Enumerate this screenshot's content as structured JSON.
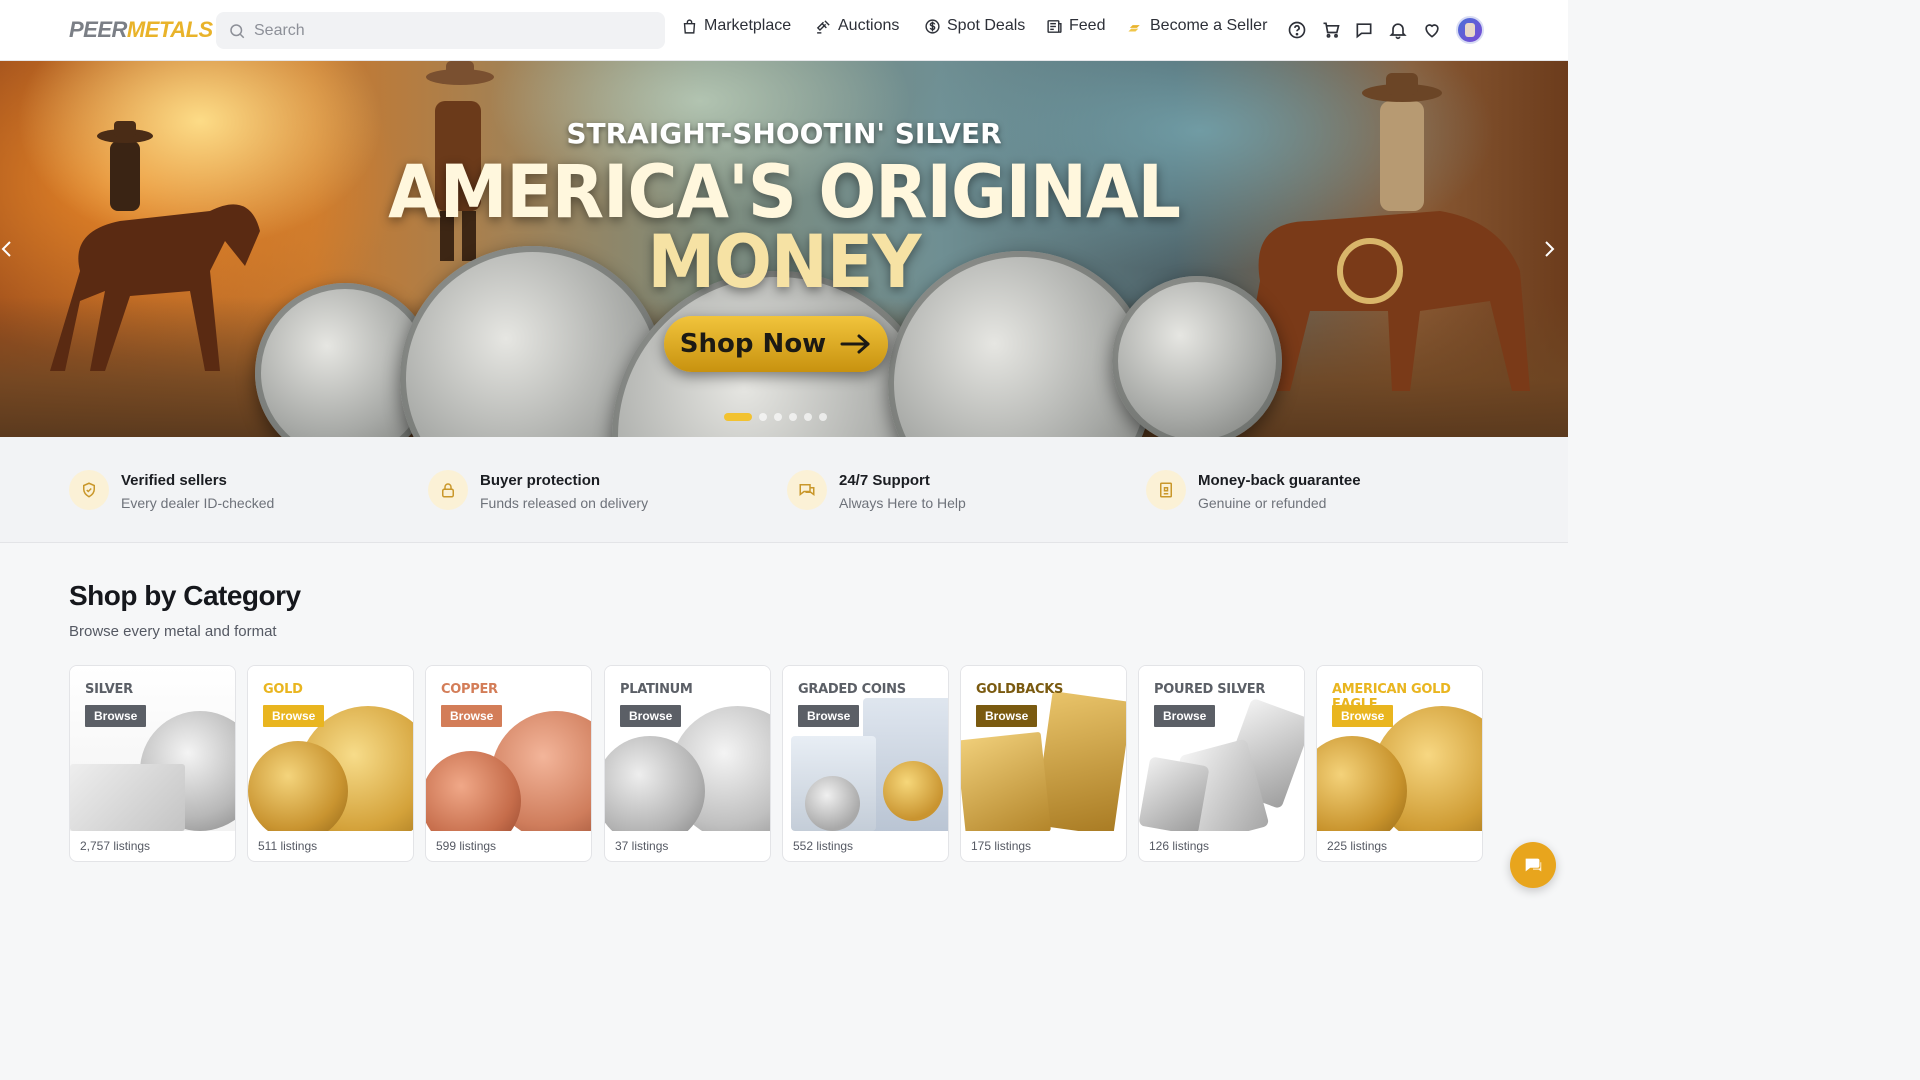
{
  "brand": {
    "name_part1": "PEER",
    "name_part2": "METALS"
  },
  "search": {
    "placeholder": "Search"
  },
  "nav": {
    "marketplace": "Marketplace",
    "auctions": "Auctions",
    "spot_deals": "Spot Deals",
    "feed": "Feed",
    "become_seller": "Become a Seller"
  },
  "hero": {
    "subtitle": "STRAIGHT-SHOOTIN' SILVER",
    "title_line1": "AMERICA'S ORIGINAL",
    "title_line2": "MONEY",
    "cta": "Shop Now",
    "slides": 6,
    "active_slide": 1
  },
  "features": [
    {
      "title": "Verified sellers",
      "desc": "Every dealer ID-checked",
      "icon": "shield-check-icon"
    },
    {
      "title": "Buyer protection",
      "desc": "Funds released on delivery",
      "icon": "lock-icon"
    },
    {
      "title": "24/7 Support",
      "desc": "Always Here to Help",
      "icon": "chat-icon"
    },
    {
      "title": "Money-back guarantee",
      "desc": "Genuine or refunded",
      "icon": "receipt-icon"
    }
  ],
  "categories_section": {
    "title": "Shop by Category",
    "subtitle": "Browse every metal and format",
    "browse_label": "Browse",
    "items": [
      {
        "name": "SILVER",
        "count": "2,757 listings",
        "color": "#5b5f66"
      },
      {
        "name": "GOLD",
        "count": "511 listings",
        "color": "#e9b51f"
      },
      {
        "name": "COPPER",
        "count": "599 listings",
        "color": "#d37d58"
      },
      {
        "name": "PLATINUM",
        "count": "37 listings",
        "color": "#5b5f66"
      },
      {
        "name": "GRADED COINS",
        "count": "552 listings",
        "color": "#5b5f66"
      },
      {
        "name": "GOLDBACKS",
        "count": "175 listings",
        "color": "#7a5a10"
      },
      {
        "name": "POURED SILVER",
        "count": "126 listings",
        "color": "#5b5f66"
      },
      {
        "name": "AMERICAN GOLD EAGLE",
        "count": "225 listings",
        "color": "#e9b51f"
      }
    ]
  },
  "colors": {
    "accent": "#f2c230",
    "brand_gold": "#e9b32a",
    "fab": "#e8a51d"
  }
}
